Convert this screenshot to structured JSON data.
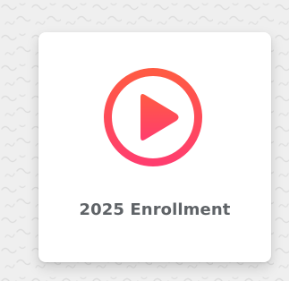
{
  "card": {
    "title": "2025 Enrollment",
    "icon": "play-circle-icon"
  },
  "colors": {
    "accent_top": "#ff5a43",
    "accent_bottom": "#ff3d6e",
    "title_text": "#5f6367",
    "background": "#efefef"
  }
}
